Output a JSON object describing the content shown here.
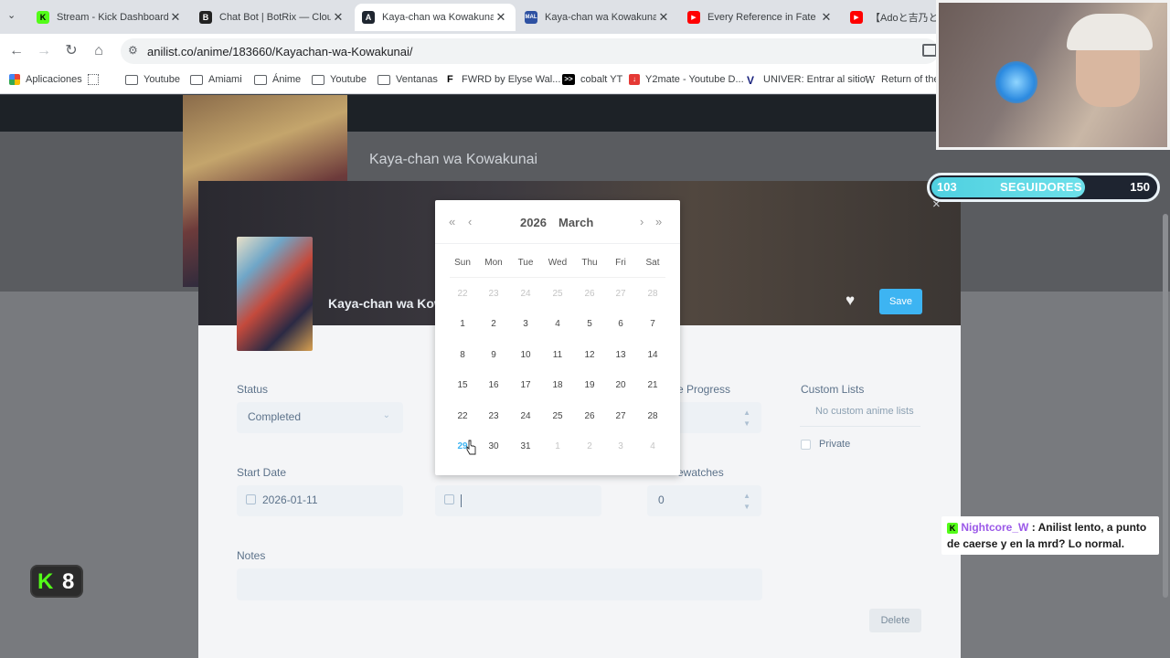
{
  "browser": {
    "tabs": [
      {
        "title": "Stream - Kick Dashboard",
        "favicon": "kick-icon",
        "color": "#53fc18",
        "glyph": "K"
      },
      {
        "title": "Chat Bot | BotRix — Cloud",
        "favicon": "botrix-icon",
        "color": "#222222",
        "glyph": "B"
      },
      {
        "title": "Kaya-chan wa Kowakunai (",
        "favicon": "anilist-icon",
        "color": "#1f2630",
        "glyph": "A",
        "active": true
      },
      {
        "title": "Kaya-chan wa Kowakunai (",
        "favicon": "mal-icon",
        "color": "#2e51a2",
        "glyph": "MAL"
      },
      {
        "title": "Every Reference in Fate Str",
        "favicon": "youtube-icon",
        "color": "#ff0000",
        "glyph": "▶"
      },
      {
        "title": "【Adoと吉乃と弱酸",
        "favicon": "youtube-icon",
        "color": "#ff0000",
        "glyph": "▶"
      }
    ],
    "url": "anilist.co/anime/183660/Kayachan-wa-Kowakunai/",
    "bookmarks": [
      {
        "label": "Aplicaciones",
        "icon": "apps-grid-icon"
      },
      {
        "label": "",
        "icon": "grid-icon"
      },
      {
        "label": "Youtube",
        "icon": "folder-icon"
      },
      {
        "label": "Amiami",
        "icon": "folder-icon"
      },
      {
        "label": "Ánime",
        "icon": "folder-icon"
      },
      {
        "label": "Youtube",
        "icon": "folder-icon"
      },
      {
        "label": "Ventanas",
        "icon": "folder-icon"
      },
      {
        "label": "FWRD by Elyse Wal...",
        "icon": "fwrd-icon"
      },
      {
        "label": "cobalt YT",
        "icon": "cobalt-icon"
      },
      {
        "label": "Y2mate - Youtube D...",
        "icon": "y2mate-icon"
      },
      {
        "label": "UNIVER: Entrar al sitio",
        "icon": "univer-icon"
      },
      {
        "label": "Return of the",
        "icon": "wikipedia-icon"
      }
    ]
  },
  "page": {
    "title": "Kaya-chan wa Kowakunai"
  },
  "modal": {
    "title": "Kaya-chan wa Kowa",
    "save_label": "Save",
    "close_glyph": "×",
    "status": {
      "label": "Status",
      "value": "Completed"
    },
    "progress": {
      "label": "e Progress"
    },
    "custom_lists": {
      "label": "Custom Lists",
      "empty_text": "No custom anime lists",
      "private_label": "Private"
    },
    "start_date": {
      "label": "Start Date",
      "value": "2026-01-11"
    },
    "finish_date": {
      "value": ""
    },
    "rewatches": {
      "label": "ewatches",
      "value": "0"
    },
    "notes": {
      "label": "Notes",
      "value": ""
    },
    "delete_label": "Delete"
  },
  "datepicker": {
    "year": "2026",
    "month": "March",
    "weekdays": [
      "Sun",
      "Mon",
      "Tue",
      "Wed",
      "Thu",
      "Fri",
      "Sat"
    ],
    "weeks": [
      [
        "22",
        "23",
        "24",
        "25",
        "26",
        "27",
        "28"
      ],
      [
        "1",
        "2",
        "3",
        "4",
        "5",
        "6",
        "7"
      ],
      [
        "8",
        "9",
        "10",
        "11",
        "12",
        "13",
        "14"
      ],
      [
        "15",
        "16",
        "17",
        "18",
        "19",
        "20",
        "21"
      ],
      [
        "22",
        "23",
        "24",
        "25",
        "26",
        "27",
        "28"
      ],
      [
        "29",
        "30",
        "31",
        "1",
        "2",
        "3",
        "4"
      ]
    ],
    "muted_first_week": true,
    "today": "29"
  },
  "stream_overlay": {
    "followers_current": "103",
    "followers_label": "SEGUIDORES",
    "followers_goal": "150",
    "followers_progress": 0.687,
    "chat_user": "Nightcore_W",
    "chat_message": ": Anilist lento, a punto de caerse y en la mrd? Lo normal.",
    "kick_viewers": "8",
    "accent": "#53fc18"
  }
}
